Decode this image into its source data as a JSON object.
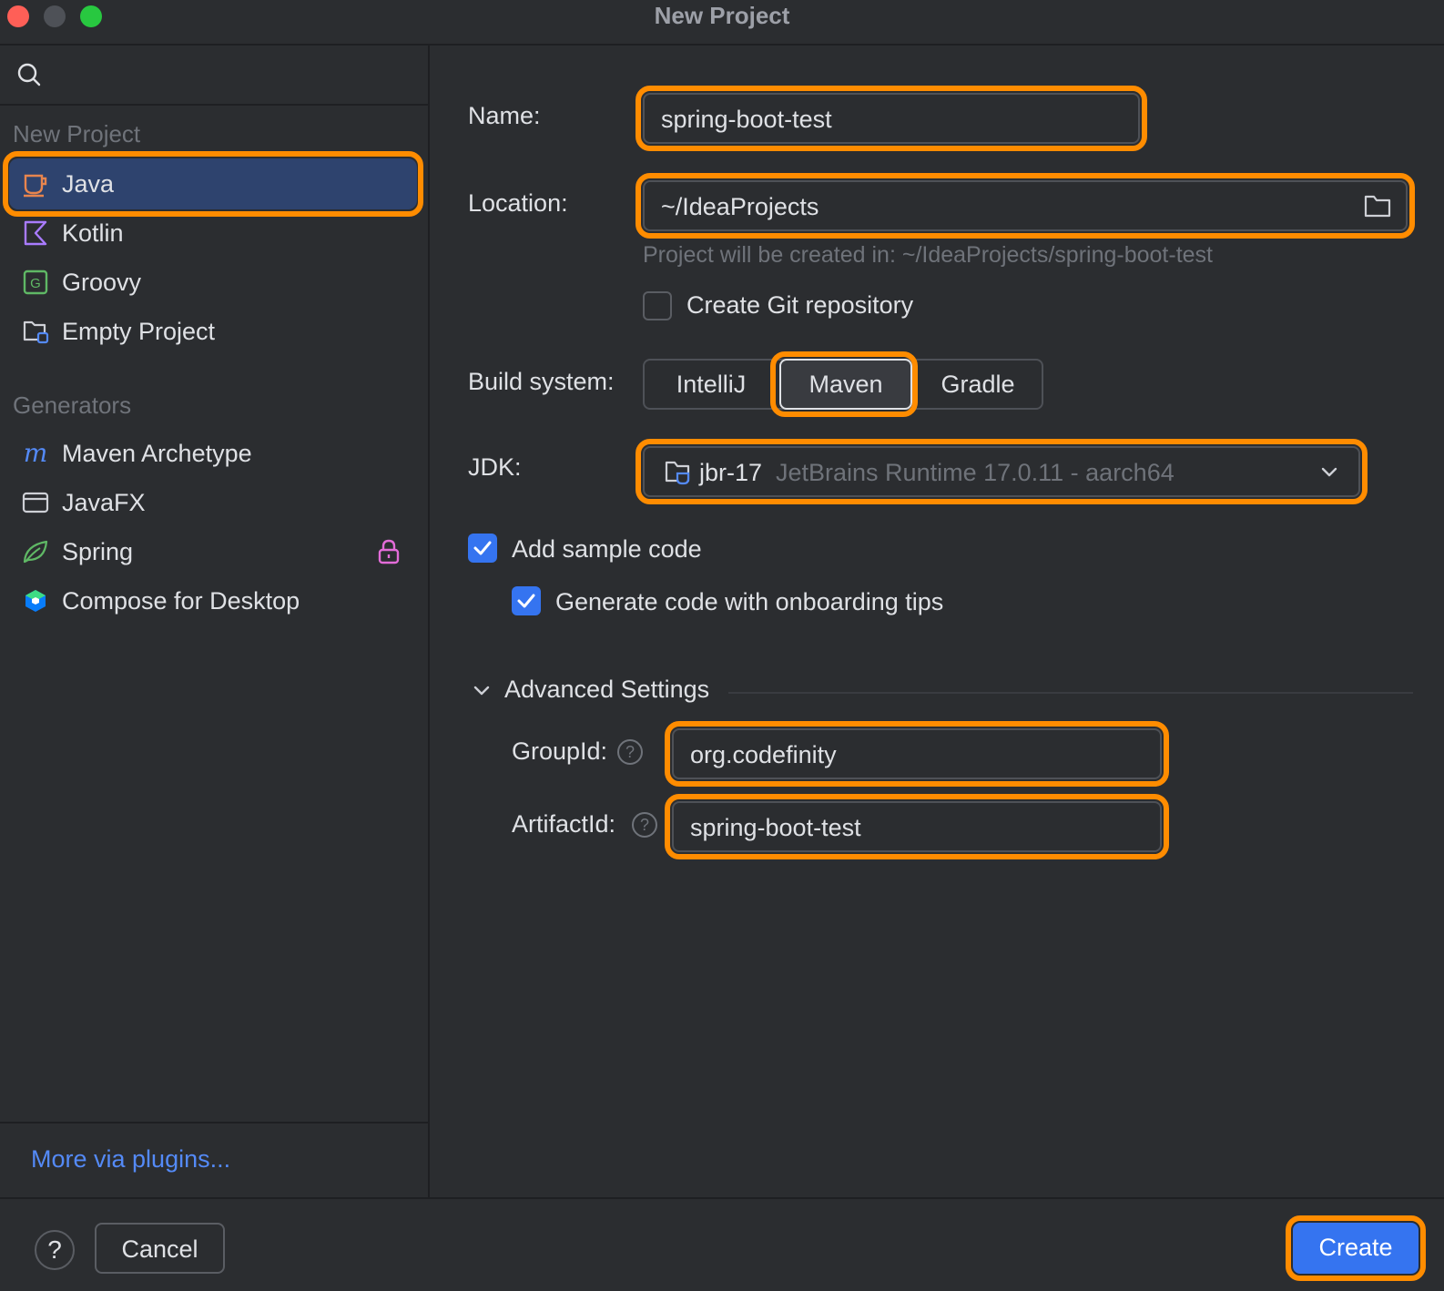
{
  "window": {
    "title": "New Project"
  },
  "sidebar": {
    "search_icon": "search-icon",
    "new_project_label": "New Project",
    "new_project_items": [
      {
        "label": "Java",
        "icon": "java-cup-icon",
        "selected": true
      },
      {
        "label": "Kotlin",
        "icon": "kotlin-icon"
      },
      {
        "label": "Groovy",
        "icon": "groovy-icon"
      },
      {
        "label": "Empty Project",
        "icon": "empty-project-icon"
      }
    ],
    "generators_label": "Generators",
    "generator_items": [
      {
        "label": "Maven Archetype",
        "icon": "maven-icon"
      },
      {
        "label": "JavaFX",
        "icon": "javafx-window-icon"
      },
      {
        "label": "Spring",
        "icon": "spring-leaf-icon",
        "locked": true
      },
      {
        "label": "Compose for Desktop",
        "icon": "compose-icon"
      }
    ],
    "more_link": "More via plugins..."
  },
  "form": {
    "name_label": "Name:",
    "name_value": "spring-boot-test",
    "location_label": "Location:",
    "location_value": "~/IdeaProjects",
    "location_hint": "Project will be created in: ~/IdeaProjects/spring-boot-test",
    "git_label": "Create Git repository",
    "git_checked": false,
    "build_label": "Build system:",
    "build_options": [
      "IntelliJ",
      "Maven",
      "Gradle"
    ],
    "build_selected": "Maven",
    "jdk_label": "JDK:",
    "jdk_name": "jbr-17",
    "jdk_detail": "JetBrains Runtime 17.0.11 - aarch64",
    "sample_code_label": "Add sample code",
    "sample_code_checked": true,
    "onboarding_label": "Generate code with onboarding tips",
    "onboarding_checked": true,
    "advanced_label": "Advanced Settings",
    "groupid_label": "GroupId:",
    "groupid_value": "org.codefinity",
    "artifactid_label": "ArtifactId:",
    "artifactid_value": "spring-boot-test"
  },
  "footer": {
    "help_label": "?",
    "cancel_label": "Cancel",
    "create_label": "Create"
  },
  "colors": {
    "accent": "#3574f0",
    "highlight": "#ff8c00",
    "link": "#548af7"
  }
}
